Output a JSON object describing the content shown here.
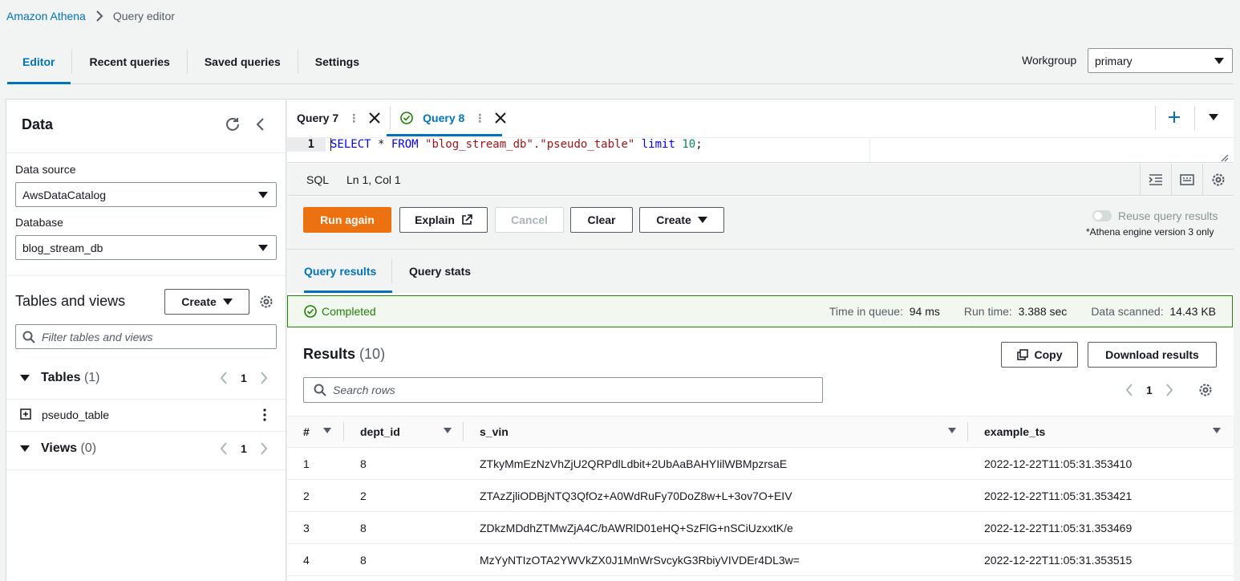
{
  "breadcrumb": {
    "root": "Amazon Athena",
    "current": "Query editor"
  },
  "top_tabs": [
    "Editor",
    "Recent queries",
    "Saved queries",
    "Settings"
  ],
  "workgroup": {
    "label": "Workgroup",
    "value": "primary"
  },
  "data_panel": {
    "title": "Data",
    "data_source_label": "Data source",
    "data_source_value": "AwsDataCatalog",
    "database_label": "Database",
    "database_value": "blog_stream_db",
    "tables_views_title": "Tables and views",
    "create_label": "Create",
    "filter_placeholder": "Filter tables and views",
    "tables_title": "Tables",
    "tables_count": "(1)",
    "tables_page": "1",
    "table_item": "pseudo_table",
    "views_title": "Views",
    "views_count": "(0)",
    "views_page": "1"
  },
  "query_tabs": [
    {
      "label": "Query 7"
    },
    {
      "label": "Query 8"
    }
  ],
  "editor": {
    "line_number": "1",
    "code_kw1": "SELECT",
    "code_mid1": " * ",
    "code_kw2": "FROM",
    "code_str": " \"blog_stream_db\".\"pseudo_table\" ",
    "code_kw3": "limit",
    "code_num": " 10",
    "code_end": ";",
    "language": "SQL",
    "cursor": "Ln 1, Col 1"
  },
  "actions": {
    "run_again": "Run again",
    "explain": "Explain",
    "cancel": "Cancel",
    "clear": "Clear",
    "create": "Create",
    "reuse_label": "Reuse query results",
    "reuse_note": "*Athena engine version 3 only"
  },
  "result_tabs": [
    "Query results",
    "Query stats"
  ],
  "status": {
    "text": "Completed",
    "queue_label": "Time in queue:",
    "queue_value": "94 ms",
    "runtime_label": "Run time:",
    "runtime_value": "3.388 sec",
    "scanned_label": "Data scanned:",
    "scanned_value": "14.43 KB"
  },
  "results": {
    "title": "Results",
    "count": "(10)",
    "copy": "Copy",
    "download": "Download results",
    "search_placeholder": "Search rows",
    "page": "1",
    "columns": [
      "#",
      "dept_id",
      "s_vin",
      "example_ts"
    ],
    "rows": [
      [
        "1",
        "8",
        "ZTkyMmEzNzVhZjU2QRPdlLdbit+2UbAaBAHYIilWBMpzrsaE",
        "2022-12-22T11:05:31.353410"
      ],
      [
        "2",
        "2",
        "ZTAzZjliODBjNTQ3QfOz+A0WdRuFy70DoZ8w+L+3ov7O+EIV",
        "2022-12-22T11:05:31.353421"
      ],
      [
        "3",
        "8",
        "ZDkzMDdhZTMwZjA4C/bAWRlD01eHQ+SzFlG+nSCiUzxxtK/e",
        "2022-12-22T11:05:31.353469"
      ],
      [
        "4",
        "8",
        "MzYyNTIzOTA2YWVkZX0J1MnWrSvcykG3RbiyVIVDEr4DL3w=",
        "2022-12-22T11:05:31.353515"
      ]
    ]
  }
}
